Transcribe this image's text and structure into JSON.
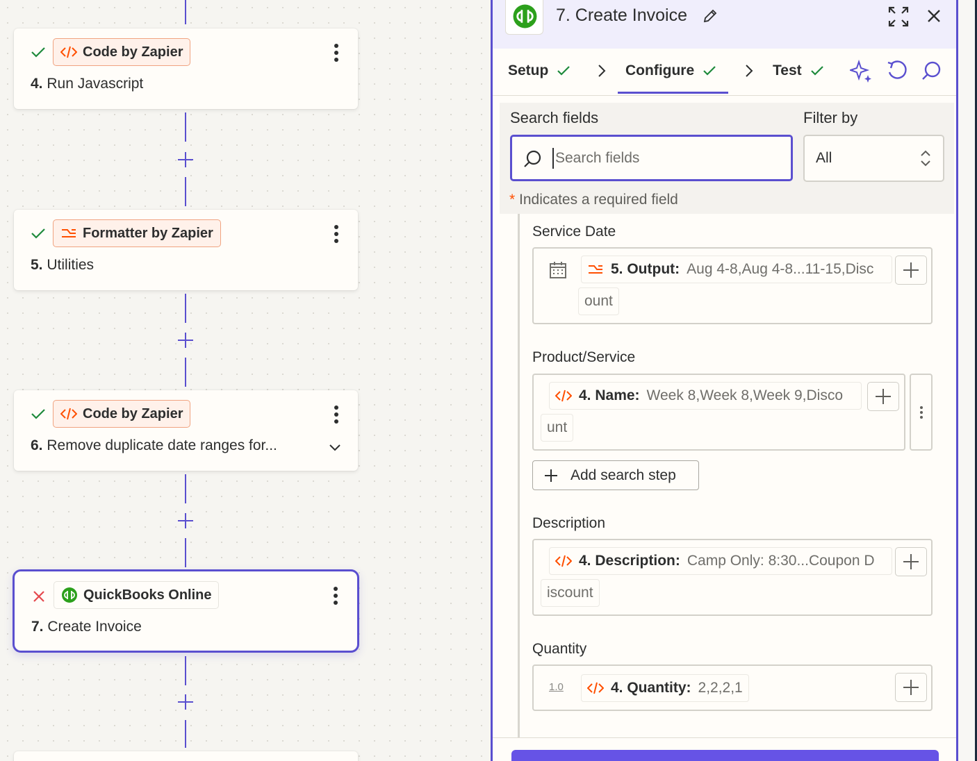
{
  "canvas": {
    "steps": [
      {
        "status": "success",
        "app": "Code by Zapier",
        "app_icon": "code-icon",
        "number": "4.",
        "name": "Run Javascript"
      },
      {
        "status": "success",
        "app": "Formatter by Zapier",
        "app_icon": "formatter-icon",
        "number": "5.",
        "name": "Utilities"
      },
      {
        "status": "success",
        "app": "Code by Zapier",
        "app_icon": "code-icon",
        "number": "6.",
        "name": "Remove duplicate date ranges for..."
      },
      {
        "status": "error",
        "app": "QuickBooks Online",
        "app_icon": "quickbooks-icon",
        "number": "7.",
        "name": "Create Invoice"
      }
    ],
    "colors": {
      "accent": "#5a4fcf",
      "success": "#1e8a3c",
      "error": "#e5484d",
      "code_orange": "#ff4f00"
    }
  },
  "panel": {
    "title": "7. Create Invoice",
    "tabs": [
      {
        "label": "Setup",
        "done": true
      },
      {
        "label": "Configure",
        "done": true,
        "active": true
      },
      {
        "label": "Test",
        "done": true
      }
    ],
    "search": {
      "label": "Search fields",
      "placeholder": "Search fields",
      "value": ""
    },
    "filter": {
      "label": "Filter by",
      "selected": "All"
    },
    "required_note": "Indicates a required field",
    "required_marker": "*",
    "fields": {
      "service_date": {
        "label": "Service Date",
        "pill_label": "5. Output:",
        "pill_value": "Aug 4-8,Aug 4-8...11-15,Disc",
        "pill_wrap": "ount",
        "type_icon": "calendar-icon"
      },
      "product_service": {
        "label": "Product/Service",
        "pill_label": "4. Name:",
        "pill_value": "Week 8,Week 8,Week 9,Disco",
        "pill_wrap": "unt",
        "add_search_step": "Add search step"
      },
      "description": {
        "label": "Description",
        "pill_label": "4. Description:",
        "pill_value": "Camp Only: 8:30...Coupon D",
        "pill_wrap": "iscount"
      },
      "quantity": {
        "label": "Quantity",
        "type_hint": "1.0",
        "pill_label": "4. Quantity:",
        "pill_value": "2,2,2,1"
      }
    }
  }
}
